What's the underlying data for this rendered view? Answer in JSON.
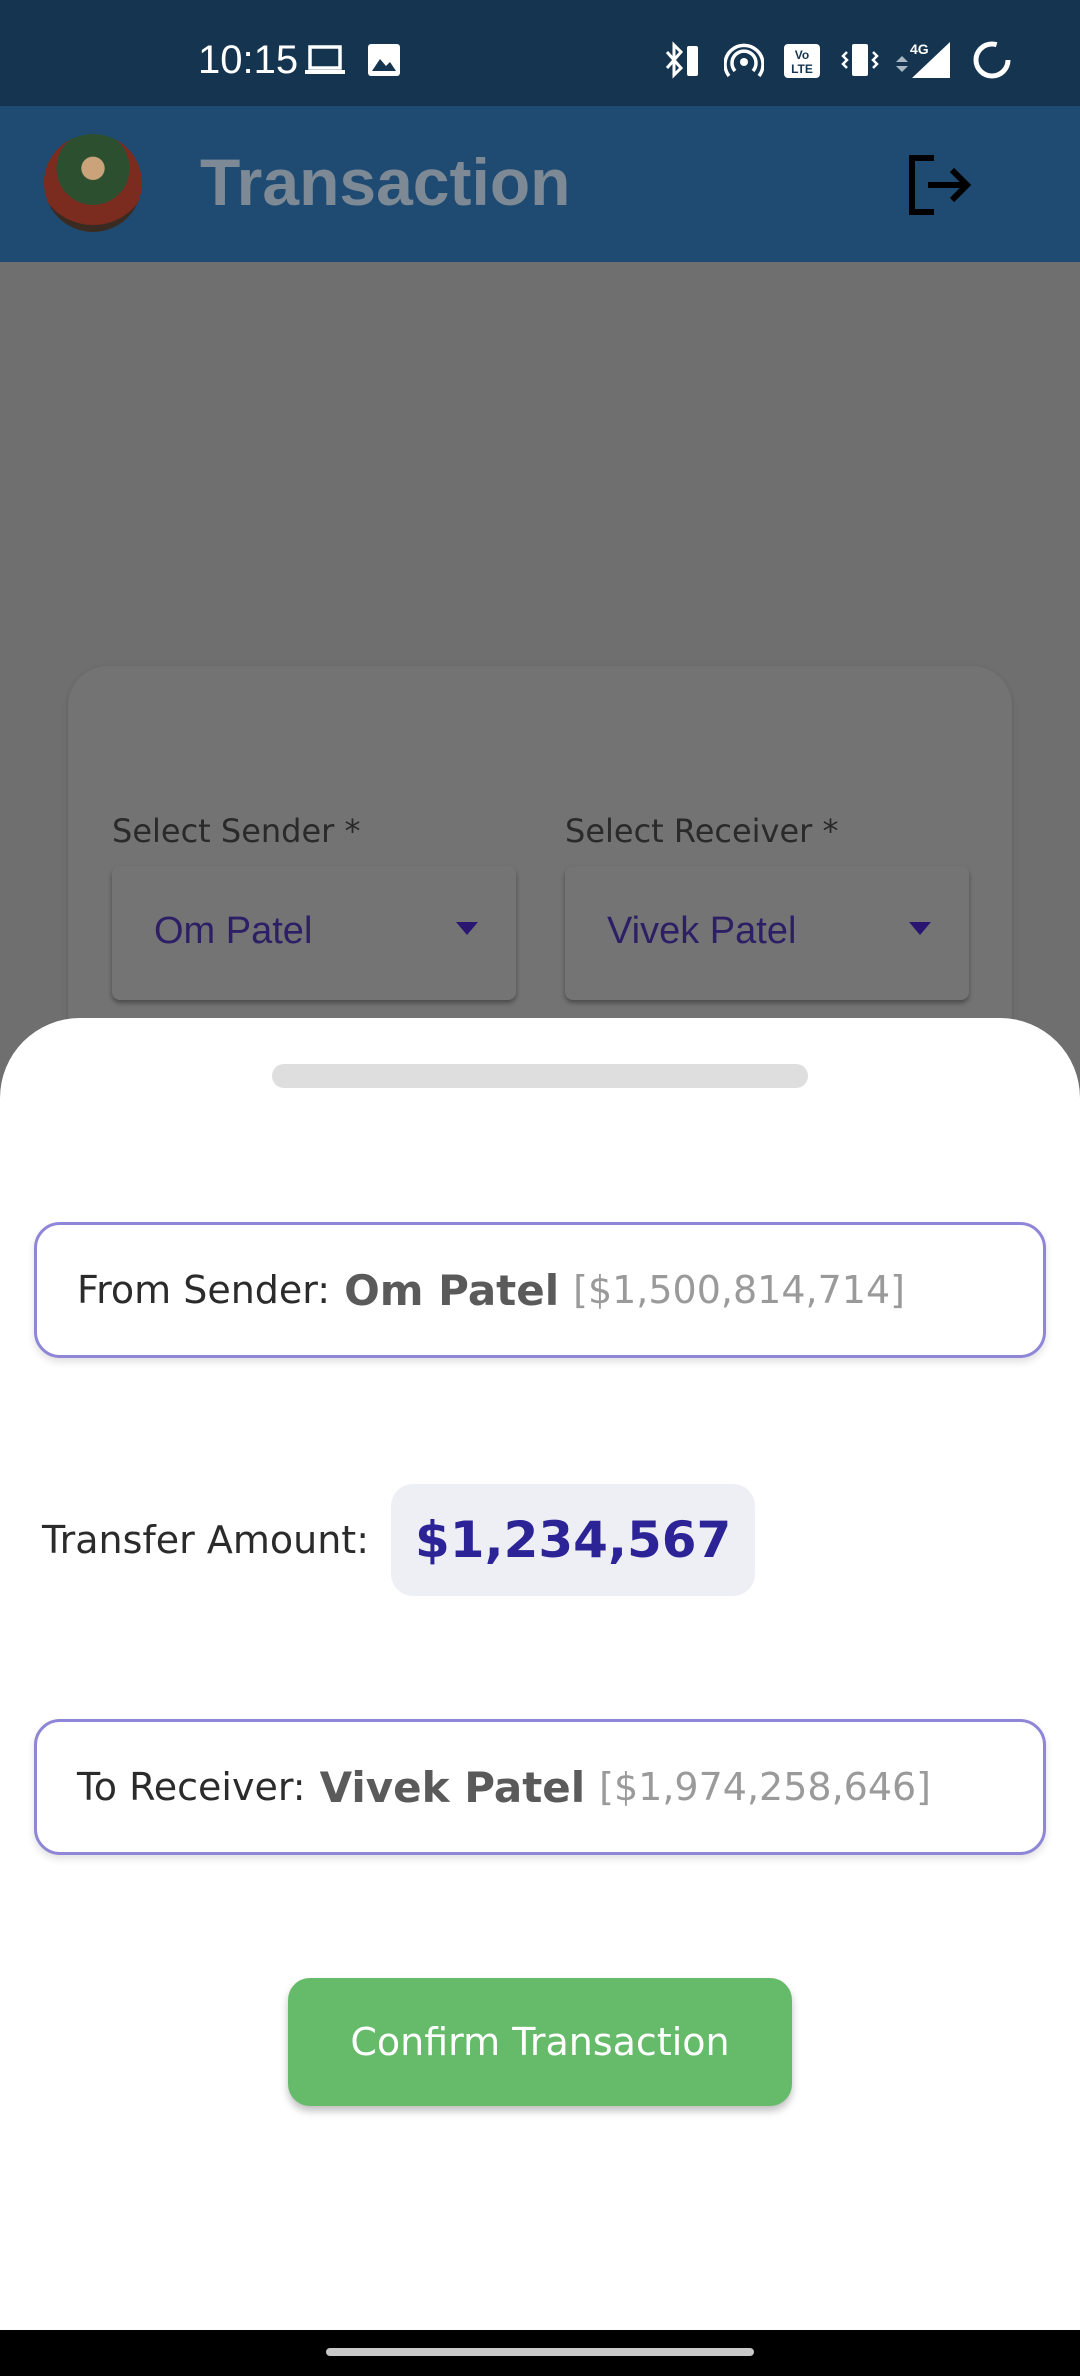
{
  "status_bar": {
    "time": "10:15",
    "left_icons": [
      "laptop-icon",
      "image-icon"
    ],
    "right_icons": [
      "bluetooth-battery-icon",
      "hotspot-icon",
      "volte-icon",
      "vibrate-icon",
      "4g-signal-icon",
      "loading-ring-icon"
    ],
    "network_label": "4G"
  },
  "app_bar": {
    "title": "Transaction",
    "avatar_icon": "avatar",
    "logout_icon": "logout-icon"
  },
  "form": {
    "sender_label": "Select Sender *",
    "receiver_label": "Select Receiver *",
    "sender_value": "Om Patel",
    "receiver_value": "Vivek Patel"
  },
  "sheet": {
    "from_label": "From Sender:",
    "from_name": "Om Patel",
    "from_balance": "[$1,500,814,714]",
    "amount_label": "Transfer Amount:",
    "amount_value": "$1,234,567",
    "to_label": "To Receiver:",
    "to_name": "Vivek Patel",
    "to_balance": "[$1,974,258,646]",
    "confirm_label": "Confirm Transaction"
  },
  "colors": {
    "status_bar": "#15344f",
    "app_bar": "#1f4b72",
    "accent_border": "#8e86d6",
    "amount_text": "#2c2496",
    "confirm_button": "#66bb6a",
    "scrim": "#6f6f6f"
  }
}
